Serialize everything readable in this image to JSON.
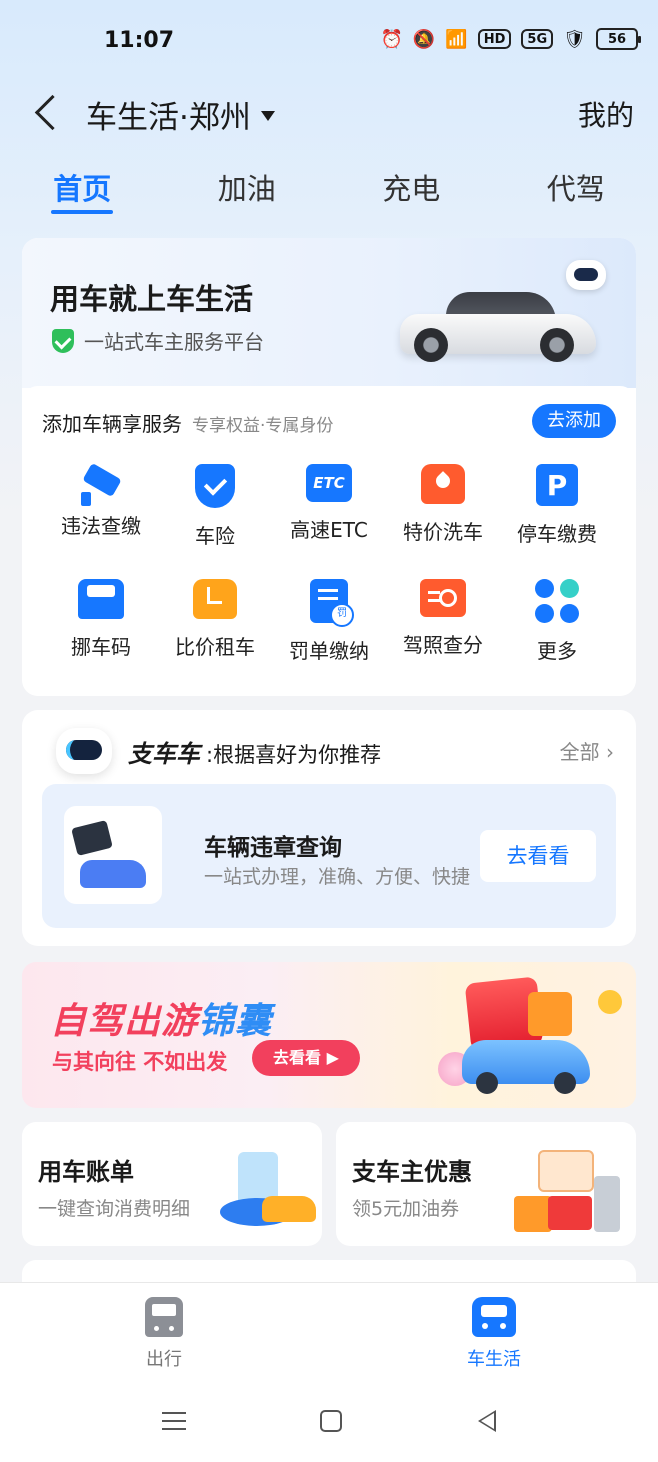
{
  "status_bar": {
    "time": "11:07",
    "hd_label": "HD",
    "network_label": "5G",
    "battery": "56",
    "icons": [
      "alarm-icon",
      "mute-icon",
      "wifi-icon",
      "hd-icon",
      "signal-5g-icon",
      "shield-dollar-icon",
      "battery-icon"
    ]
  },
  "header": {
    "city_title": "车生活·郑州",
    "mine_label": "我的"
  },
  "tabs": [
    {
      "label": "首页",
      "active": true
    },
    {
      "label": "加油",
      "active": false
    },
    {
      "label": "充电",
      "active": false
    },
    {
      "label": "代驾",
      "active": false
    }
  ],
  "hero": {
    "title": "用车就上车生活",
    "subtitle": "一站式车主服务平台"
  },
  "add_vehicle": {
    "title": "添加车辆享服务",
    "hint": "专享权益·专属身份",
    "button": "去添加"
  },
  "services": [
    {
      "label": "违法查缴",
      "icon": "camera-icon"
    },
    {
      "label": "车险",
      "icon": "insurance-shield-icon"
    },
    {
      "label": "高速ETC",
      "icon": "etc-icon",
      "icon_text": "ETC"
    },
    {
      "label": "特价洗车",
      "icon": "car-wash-icon"
    },
    {
      "label": "停车缴费",
      "icon": "parking-icon",
      "icon_text": "P"
    },
    {
      "label": "挪车码",
      "icon": "move-car-code-icon"
    },
    {
      "label": "比价租车",
      "icon": "car-rental-icon"
    },
    {
      "label": "罚单缴纳",
      "icon": "ticket-payment-icon"
    },
    {
      "label": "驾照查分",
      "icon": "license-points-icon"
    },
    {
      "label": "更多",
      "icon": "more-dots-icon"
    }
  ],
  "recommend": {
    "brand": "支车车",
    "tagline": ":根据喜好为你推荐",
    "all_label": "全部 ›",
    "item_title": "车辆违章查询",
    "item_desc": "一站式办理，准确、方便、快捷",
    "item_button": "去看看"
  },
  "banner": {
    "title_main": "自驾出游",
    "title_accent": "锦囊",
    "subtitle": "与其向往 不如出发",
    "button": "去看看 ▶"
  },
  "mini_cards": [
    {
      "title": "用车账单",
      "subtitle": "一键查询消费明细"
    },
    {
      "title": "支车主优惠",
      "subtitle": "领5元加油券"
    }
  ],
  "bottom_tabs": [
    {
      "label": "出行",
      "icon": "train-icon",
      "active": false
    },
    {
      "label": "车生活",
      "icon": "car-icon",
      "active": true
    }
  ],
  "colors": {
    "accent": "#1677ff",
    "banner_red": "#f2405d"
  }
}
